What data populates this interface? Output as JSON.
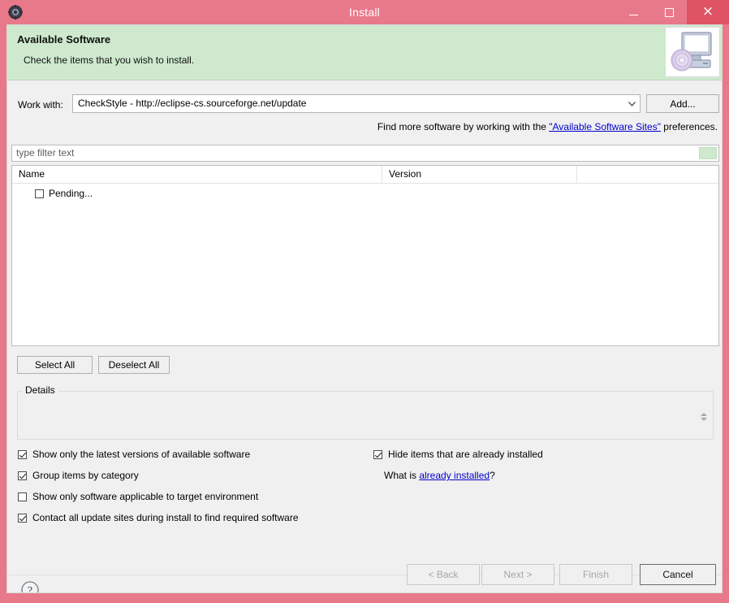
{
  "window": {
    "title": "Install",
    "icon": "gear-icon",
    "controls": {
      "minimize": "minimize-icon",
      "maximize": "maximize-icon",
      "close": "×"
    }
  },
  "banner": {
    "title": "Available Software",
    "subtitle": "Check the items that you wish to install.",
    "image": "computer-disc-icon"
  },
  "workwith": {
    "label": "Work with:",
    "value": "CheckStyle - http://eclipse-cs.sourceforge.net/update",
    "dropdown_arrow": "chevron-down-icon",
    "add_label": "Add..."
  },
  "findmore": {
    "prefix": "Find more software by working with the ",
    "link": "\"Available Software Sites\"",
    "suffix": " preferences."
  },
  "filter": {
    "placeholder": "type filter text",
    "value": "",
    "clear_icon": "clear-filter-icon"
  },
  "table": {
    "columns": [
      "Name",
      "Version",
      ""
    ],
    "rows": [
      {
        "name": "Pending...",
        "checked": false,
        "version": ""
      }
    ]
  },
  "actions": {
    "select_all": "Select All",
    "deselect_all": "Deselect All"
  },
  "details": {
    "label": "Details",
    "content": ""
  },
  "options": {
    "latest": {
      "label": "Show only the latest versions of available software",
      "checked": true
    },
    "group": {
      "label": "Group items by category",
      "checked": true
    },
    "target": {
      "label": "Show only software applicable to target environment",
      "checked": false
    },
    "contact": {
      "label": "Contact all update sites during install to find required software",
      "checked": true
    },
    "hide": {
      "label": "Hide items that are already installed",
      "checked": true
    },
    "whatis_prefix": "What is ",
    "whatis_link": "already installed",
    "whatis_suffix": "?"
  },
  "footer": {
    "help": "help-icon",
    "back": "< Back",
    "next": "Next >",
    "finish": "Finish",
    "cancel": "Cancel"
  },
  "colors": {
    "titlebar": "#e8798b",
    "close_button": "#de5464",
    "banner": "#cee9ce",
    "dialog": "#f0f0f0",
    "link": "#0000cd"
  }
}
